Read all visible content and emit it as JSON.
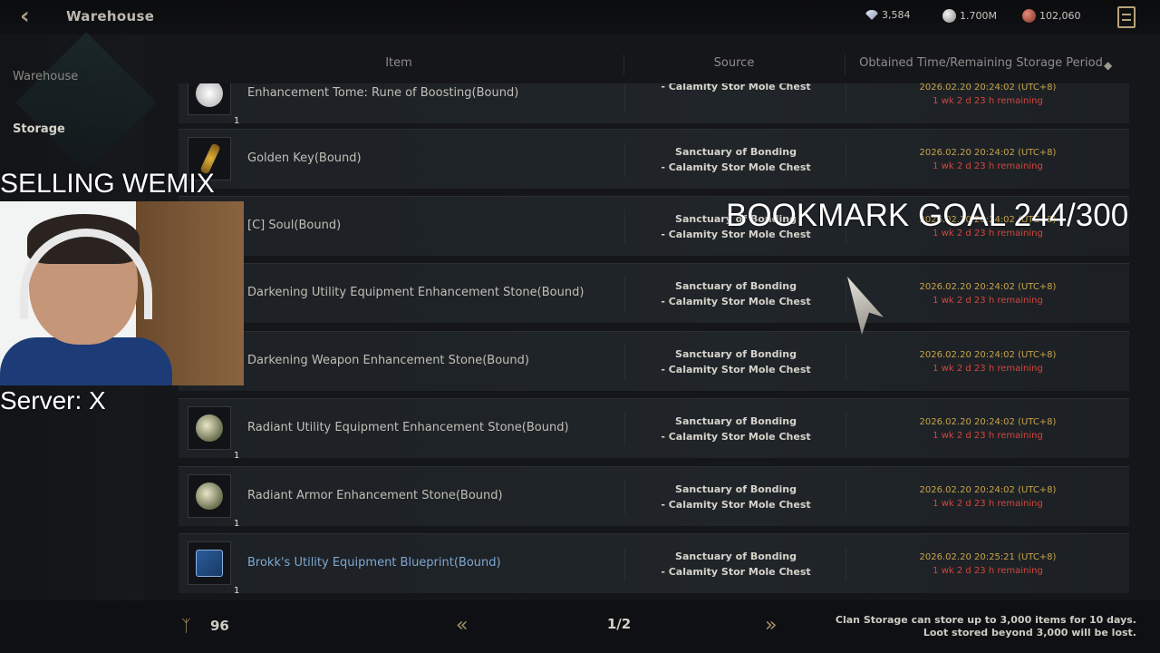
{
  "header": {
    "title": "Warehouse",
    "currencies": [
      {
        "icon": "diamond-icon",
        "value": "3,584"
      },
      {
        "icon": "silver-icon",
        "value": "1.700M"
      },
      {
        "icon": "ruby-icon",
        "value": "102,060"
      }
    ]
  },
  "sidebar": {
    "items": [
      {
        "label": "Warehouse"
      },
      {
        "label": "Storage"
      }
    ]
  },
  "columns": {
    "item": "Item",
    "source": "Source",
    "time": "Obtained Time/Remaining Storage Period"
  },
  "rows": [
    {
      "name": "Enhancement Tome: Rune of Boosting(Bound)",
      "qty": "1",
      "icon": "tome-icon",
      "source1": "",
      "source2": "- Calamity Stor Mole Chest",
      "stamp": "2026.02.20 20:24:02 (UTC+8)",
      "remain": "1 wk 2 d 23 h remaining"
    },
    {
      "name": "Golden Key(Bound)",
      "qty": "",
      "icon": "golden-key-icon",
      "source1": "Sanctuary of Bonding",
      "source2": "- Calamity Stor Mole Chest",
      "stamp": "2026.02.20 20:24:02 (UTC+8)",
      "remain": "1 wk 2 d 23 h remaining"
    },
    {
      "name": "[C] Soul(Bound)",
      "qty": "",
      "icon": "soul-icon",
      "source1": "Sanctuary of Bonding",
      "source2": "- Calamity Stor Mole Chest",
      "stamp": "2026.02.20 20:24:02 (UTC+8)",
      "remain": "1 wk 2 d 23 h remaining"
    },
    {
      "name": "Darkening Utility Equipment Enhancement Stone(Bound)",
      "qty": "",
      "icon": "stone-icon",
      "source1": "Sanctuary of Bonding",
      "source2": "- Calamity Stor Mole Chest",
      "stamp": "2026.02.20 20:24:02 (UTC+8)",
      "remain": "1 wk 2 d 23 h remaining"
    },
    {
      "name": "Darkening Weapon Enhancement Stone(Bound)",
      "qty": "",
      "icon": "stone-icon",
      "source1": "Sanctuary of Bonding",
      "source2": "- Calamity Stor Mole Chest",
      "stamp": "2026.02.20 20:24:02 (UTC+8)",
      "remain": "1 wk 2 d 23 h remaining"
    },
    {
      "name": "Radiant Utility Equipment Enhancement Stone(Bound)",
      "qty": "1",
      "icon": "stone-icon",
      "source1": "Sanctuary of Bonding",
      "source2": "- Calamity Stor Mole Chest",
      "stamp": "2026.02.20 20:24:02 (UTC+8)",
      "remain": "1 wk 2 d 23 h remaining"
    },
    {
      "name": "Radiant Armor Enhancement Stone(Bound)",
      "qty": "1",
      "icon": "stone-icon",
      "source1": "Sanctuary of Bonding",
      "source2": "- Calamity Stor Mole Chest",
      "stamp": "2026.02.20 20:24:02 (UTC+8)",
      "remain": "1 wk 2 d 23 h remaining"
    },
    {
      "name": "Brokk's Utility Equipment Blueprint(Bound)",
      "qty": "1",
      "icon": "blueprint-icon",
      "source1": "Sanctuary of Bonding",
      "source2": "- Calamity Stor Mole Chest",
      "stamp": "2026.02.20 20:25:21 (UTC+8)",
      "remain": "1 wk 2 d 23 h remaining"
    }
  ],
  "footer": {
    "bag_count": "96",
    "page": "1/2",
    "note_line1": "Clan Storage can store up to 3,000 items for 10 days.",
    "note_line2": "Loot stored beyond 3,000 will be lost."
  },
  "overlay": {
    "selling": "SELLING WEMIX",
    "bookmark": "BOOKMARK GOAL 244/300",
    "server": "Server: X"
  }
}
